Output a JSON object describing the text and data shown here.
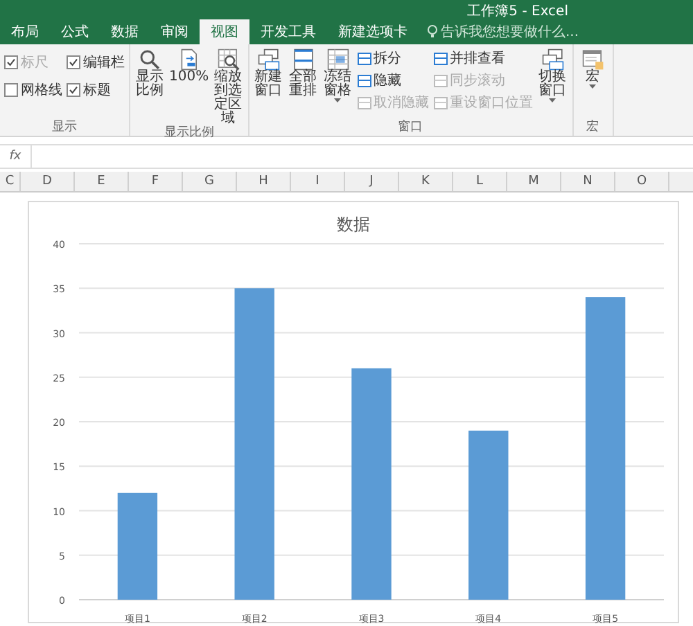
{
  "window": {
    "title": "工作簿5 - Excel"
  },
  "tabs": [
    {
      "label": "布局",
      "selected": false
    },
    {
      "label": "公式",
      "selected": false
    },
    {
      "label": "数据",
      "selected": false
    },
    {
      "label": "审阅",
      "selected": false
    },
    {
      "label": "视图",
      "selected": true
    },
    {
      "label": "开发工具",
      "selected": false
    },
    {
      "label": "新建选项卡",
      "selected": false
    }
  ],
  "tell_me": {
    "placeholder": "告诉我您想要做什么..."
  },
  "ribbon": {
    "groups": [
      {
        "label": "显示",
        "kind": "checks",
        "items": [
          {
            "label": "标尺",
            "checked": true,
            "disabled": true
          },
          {
            "label": "网格线",
            "checked": false,
            "disabled": false
          },
          {
            "label": "编辑栏",
            "checked": true,
            "disabled": false
          },
          {
            "label": "标题",
            "checked": true,
            "disabled": false
          }
        ]
      },
      {
        "label": "显示比例",
        "kind": "buttons",
        "items": [
          {
            "label": "显示比例"
          },
          {
            "label": "100%"
          },
          {
            "label": "缩放到选定区域"
          }
        ]
      },
      {
        "label": "窗口",
        "kind": "window",
        "big": [
          {
            "label": "新建窗口",
            "dropdown": false
          },
          {
            "label": "全部重排",
            "dropdown": false
          },
          {
            "label": "冻结窗格",
            "dropdown": true
          }
        ],
        "small": [
          [
            {
              "label": "拆分",
              "disabled": false
            },
            {
              "label": "隐藏",
              "disabled": false
            },
            {
              "label": "取消隐藏",
              "disabled": true
            }
          ],
          [
            {
              "label": "并排查看",
              "disabled": false
            },
            {
              "label": "同步滚动",
              "disabled": true
            },
            {
              "label": "重设窗口位置",
              "disabled": true
            }
          ]
        ],
        "switch": {
          "label": "切换窗口",
          "dropdown": true
        }
      },
      {
        "label": "宏",
        "kind": "buttons",
        "items": [
          {
            "label": "宏",
            "dropdown": true
          }
        ]
      }
    ]
  },
  "formula_bar": {
    "fx": "fx"
  },
  "columns": [
    "C",
    "D",
    "E",
    "F",
    "G",
    "H",
    "I",
    "J",
    "K",
    "L",
    "M",
    "N",
    "O"
  ],
  "chart": {
    "chart_data": {
      "type": "bar",
      "grid": true,
      "title": "数据",
      "categories": [
        "项目1",
        "项目2",
        "项目3",
        "项目4",
        "项目5"
      ],
      "values": [
        12,
        35,
        26,
        19,
        34
      ],
      "ylim": [
        0,
        40
      ],
      "yticks": [
        0,
        5,
        10,
        15,
        20,
        25,
        30,
        35,
        40
      ]
    }
  }
}
